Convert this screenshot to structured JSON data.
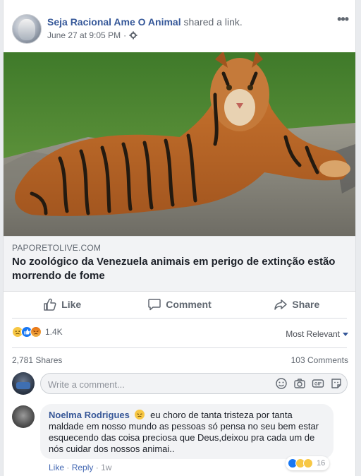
{
  "post": {
    "page_name": "Seja Racional Ame O Animal",
    "action_text": "shared a link.",
    "timestamp": "June 27 at 9:05 PM",
    "separator": "·",
    "audience_icon": "gear-icon",
    "more_icon": "more-options-icon",
    "more_label": "•••"
  },
  "link_preview": {
    "image": "tiger-photo",
    "domain": "PAPORETOLIVE.COM",
    "title": "No zoológico da Venezuela animais em perigo de extinção estão morrendo de fome"
  },
  "actions": {
    "like": "Like",
    "comment": "Comment",
    "share": "Share"
  },
  "reactions": {
    "types": [
      "sad",
      "like",
      "angry"
    ],
    "count": "1.4K",
    "sort_label": "Most Relevant"
  },
  "stats": {
    "shares": "2,781 Shares",
    "comments": "103 Comments"
  },
  "comment_box": {
    "placeholder": "Write a comment...",
    "icons": [
      "emoji-icon",
      "camera-icon",
      "gif-icon",
      "sticker-icon"
    ]
  },
  "comments": [
    {
      "author": "Noelma Rodrigues",
      "emoji": "sad-face-emoji",
      "text": "eu choro de tanta tristeza por tanta maldade em nosso mundo as pessoas só pensa no seu bem estar esquecendo das coisa preciosa que Deus,deixou pra cada um de nós cuidar dos nossos animai..",
      "like_label": "Like",
      "reply_label": "Reply",
      "age": "1w",
      "reaction_count": "16",
      "reaction_types": [
        "like",
        "sad",
        "wow"
      ]
    }
  ],
  "colors": {
    "link_blue": "#365899",
    "meta_gray": "#616770",
    "like_blue": "#1877f2",
    "panel_gray": "#f2f3f5"
  }
}
